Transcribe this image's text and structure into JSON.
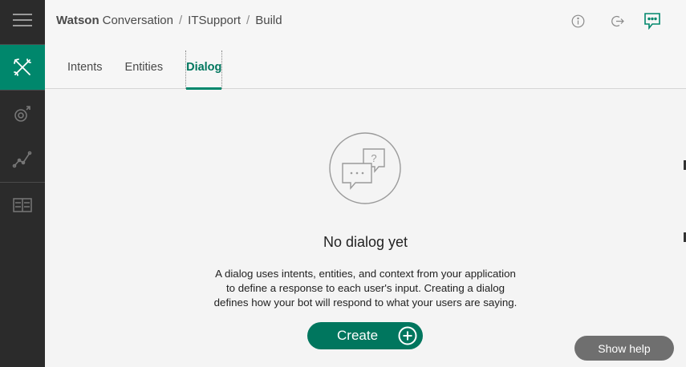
{
  "sidebar": {
    "items": [
      {
        "icon": "hamburger-menu-icon"
      },
      {
        "icon": "build-tools-icon"
      },
      {
        "icon": "improve-icon"
      },
      {
        "icon": "deploy-graph-icon"
      },
      {
        "icon": "workspaces-icon"
      }
    ],
    "active_color": "#00876c"
  },
  "header": {
    "brand_strong": "Watson",
    "brand_rest": "Conversation",
    "separator": "/",
    "crumbs": [
      "ITSupport",
      "Build"
    ],
    "icons": [
      "info-icon",
      "exit-icon",
      "chat-feedback-icon"
    ]
  },
  "tabs": [
    {
      "label": "Intents",
      "active": false
    },
    {
      "label": "Entities",
      "active": false
    },
    {
      "label": "Dialog",
      "active": true
    }
  ],
  "empty_state": {
    "icon": "dialog-chat-bubbles-icon",
    "title": "No dialog yet",
    "description_lines": [
      "A dialog uses intents, entities, and context from your application",
      "to define a response to each user's input. Creating a dialog",
      "defines how your bot will respond to what your users are saying."
    ],
    "create_label": "Create"
  },
  "help": {
    "label": "Show help"
  },
  "colors": {
    "accent": "#00765e",
    "sidebar": "#2b2b2b",
    "help_button": "#6f6f6f"
  }
}
